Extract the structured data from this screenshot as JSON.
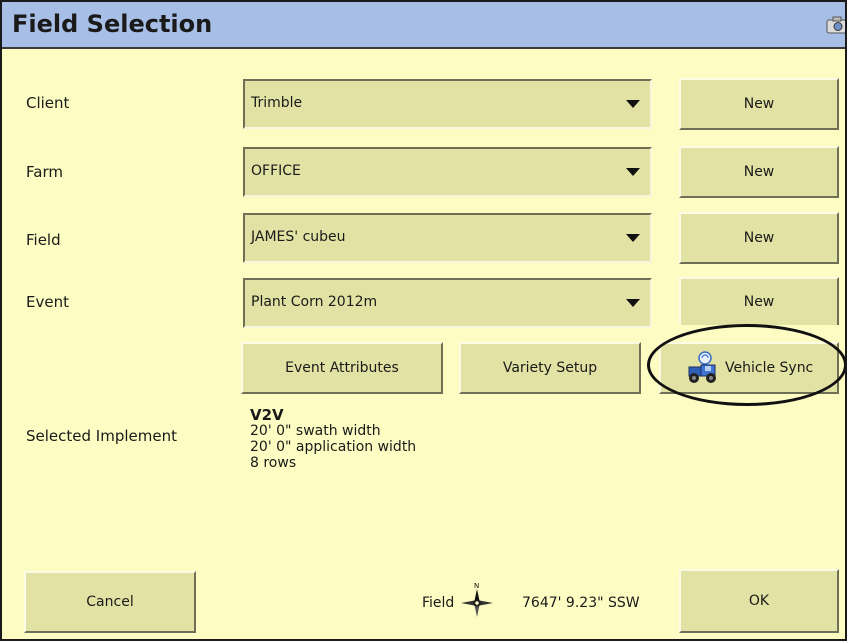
{
  "window": {
    "title": "Field Selection"
  },
  "rows": [
    {
      "label": "Client",
      "value": "Trimble",
      "button": "New"
    },
    {
      "label": "Farm",
      "value": "OFFICE",
      "button": "New"
    },
    {
      "label": "Field",
      "value": "JAMES' cubeu",
      "button": "New"
    },
    {
      "label": "Event",
      "value": "Plant Corn 2012m",
      "button": "New"
    }
  ],
  "actions": {
    "event_attributes": "Event Attributes",
    "variety_setup": "Variety Setup",
    "vehicle_sync": "Vehicle Sync"
  },
  "implement": {
    "label": "Selected Implement",
    "name": "V2V",
    "swath": "20' 0\" swath width",
    "application": "20' 0\" application width",
    "rows": "8 rows"
  },
  "footer": {
    "cancel": "Cancel",
    "ok": "OK",
    "field_label": "Field",
    "distance": "7647' 9.23\" SSW"
  },
  "icons": {
    "title": "camera-icon",
    "vehicle_sync": "vehicle-sync-icon",
    "compass": "compass-icon"
  }
}
